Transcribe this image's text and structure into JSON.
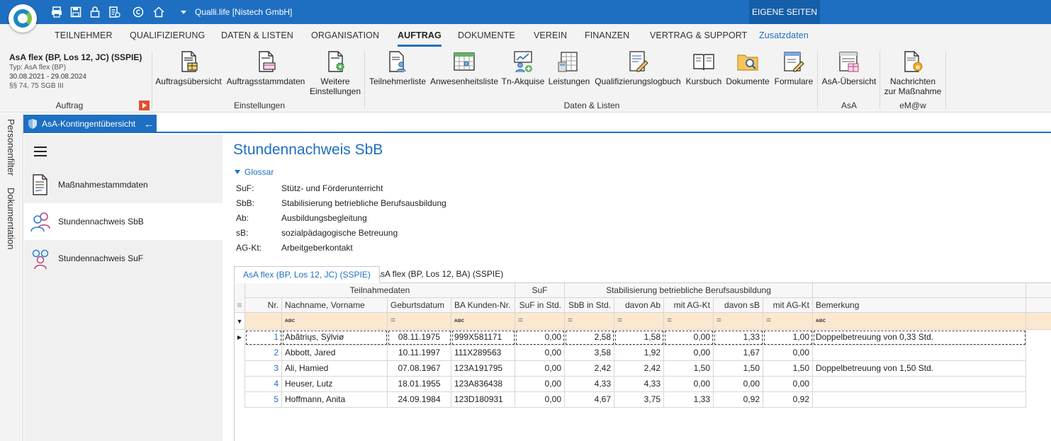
{
  "titlebar": {
    "app_title": "Qualli.life [Nistech GmbH]",
    "own_pages": "EIGENE SEITEN",
    "quick_access_icons": [
      "print-icon",
      "save-icon",
      "lock-icon",
      "document-list-icon",
      "copyright-icon",
      "home-icon",
      "dropdown-icon"
    ]
  },
  "menu": {
    "tabs": [
      "TEILNEHMER",
      "QUALIFIZIERUNG",
      "DATEN & LISTEN",
      "ORGANISATION",
      "AUFTRAG",
      "DOKUMENTE",
      "VEREIN",
      "FINANZEN",
      "VERTRAG & SUPPORT",
      "Zusatzdaten"
    ],
    "active": "AUFTRAG"
  },
  "ribbon": {
    "context": {
      "title": "AsA flex (BP, Los 12, JC) (SSPIE)",
      "type": "Typ: AsA flex (BP)",
      "period": "30.08.2021 - 29.08.2024",
      "law": "§§ 74, 75 SGB III",
      "group_label": "Auftrag"
    },
    "groups": [
      {
        "label": "Einstellungen",
        "buttons": [
          "Auftragsübersicht",
          "Auftragsstammdaten",
          "Weitere",
          "Einstellungen"
        ]
      },
      {
        "label": "Daten & Listen",
        "buttons": [
          "Teilnehmerliste",
          "Anwesenheitsliste",
          "Tn-Akquise",
          "Leistungen",
          "Qualifizierungslogbuch",
          "Kursbuch",
          "Dokumente",
          "Formulare"
        ]
      },
      {
        "label": "AsA",
        "buttons": [
          "AsA-Übersicht"
        ]
      },
      {
        "label": "eM@w",
        "buttons": [
          "Nachrichten",
          "zur Maßnahme"
        ]
      }
    ]
  },
  "side_tabs": [
    "Personenfilter",
    "Dokumentation"
  ],
  "doc_tab": {
    "label": "AsA-Kontingentübersicht"
  },
  "leftnav": {
    "items": [
      {
        "label": "Maßnahmestammdaten"
      },
      {
        "label": "Stundennachweis SbB"
      },
      {
        "label": "Stundennachweis SuF"
      }
    ]
  },
  "main": {
    "title": "Stundennachweis SbB",
    "glossar_label": "Glossar",
    "glossar": [
      {
        "abbr": "SuF:",
        "desc": "Stütz- und Förderunterricht"
      },
      {
        "abbr": "SbB:",
        "desc": "Stabilisierung betriebliche Berufsausbildung"
      },
      {
        "abbr": "Ab:",
        "desc": "Ausbildungsbegleitung"
      },
      {
        "abbr": "sB:",
        "desc": "sozialpädagogische Betreuung"
      },
      {
        "abbr": "AG-Kt:",
        "desc": "Arbeitgeberkontakt"
      }
    ],
    "data_tabs": [
      "AsA flex (BP, Los 12, JC) (SSPIE)",
      "AsA flex (BP, Los 12, BA) (SSPIE)"
    ],
    "grid": {
      "group_headers": [
        "Teilnahmedaten",
        "SuF",
        "Stabilisierung betriebliche Berufsausbildung"
      ],
      "columns": [
        "Nr.",
        "Nachname, Vorname",
        "Geburtsdatum",
        "BA Kunden-Nr.",
        "SuF in Std.",
        "SbB in Std.",
        "davon Ab",
        "mit AG-Kt",
        "davon sB",
        "mit AG-Kt",
        "Bemerkung"
      ],
      "filter_text_icon": "ᴀʙc",
      "filter_eq_icon": "=",
      "rows": [
        [
          "1",
          "Abãtriųs, Sÿlviø",
          "08.11.1975",
          "999X581171",
          "0,00",
          "2,58",
          "1,58",
          "0,00",
          "1,33",
          "1,00",
          "Doppelbetreuung von 0,33 Std."
        ],
        [
          "2",
          "Abbott, Jared",
          "10.11.1997",
          "111X289563",
          "0,00",
          "3,58",
          "1,92",
          "0,00",
          "1,67",
          "0,00",
          ""
        ],
        [
          "3",
          "Ali, Hamied",
          "07.08.1967",
          "123A191795",
          "0,00",
          "2,42",
          "2,42",
          "1,50",
          "1,50",
          "1,50",
          "Doppelbetreuung von 1,50 Std."
        ],
        [
          "4",
          "Heuser, Lutz",
          "18.01.1955",
          "123A836438",
          "0,00",
          "4,33",
          "4,33",
          "0,00",
          "0,00",
          "0,00",
          ""
        ],
        [
          "5",
          "Hoffmann, Anita",
          "24.09.1984",
          "123D180931",
          "0,00",
          "4,67",
          "3,75",
          "1,33",
          "0,92",
          "0,92",
          ""
        ]
      ]
    }
  },
  "colors": {
    "accent": "#1e6fc1",
    "filter_row": "#fbe8cf",
    "ribbon_bg": "#f3f3f3"
  }
}
